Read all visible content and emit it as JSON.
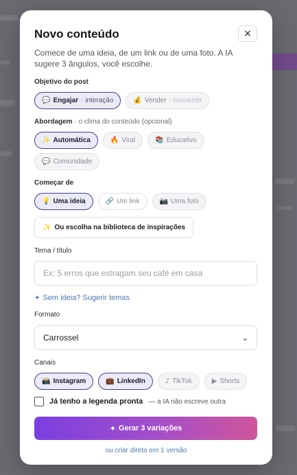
{
  "modal": {
    "title": "Novo conteúdo",
    "close_icon": "×",
    "subtitle": "Comece de uma ideia, de um link ou de uma foto. A IA sugere 3 ângulos, você escolhe."
  },
  "objective": {
    "label": "Objetivo do post",
    "options": [
      {
        "icon": "💬",
        "label": "Engajar",
        "sub": "· interação",
        "selected": true
      },
      {
        "icon": "💰",
        "label": "Vender",
        "sub": "· converter",
        "selected": false
      }
    ]
  },
  "approach": {
    "label": "Abordagem",
    "hint": " · o clima do conteúdo (opcional)",
    "options": [
      {
        "icon": "✨",
        "label": "Automática",
        "selected": true
      },
      {
        "icon": "🔥",
        "label": "Viral",
        "selected": false
      },
      {
        "icon": "📚",
        "label": "Educativo",
        "selected": false
      },
      {
        "icon": "💬",
        "label": "Comunidade",
        "selected": false
      }
    ]
  },
  "start_from": {
    "label": "Começar de",
    "options": [
      {
        "icon": "💡",
        "label": "Uma ideia",
        "selected": true
      },
      {
        "icon": "🔗",
        "label": "Um link",
        "selected": false
      },
      {
        "icon": "📷",
        "label": "Uma foto",
        "selected": false
      }
    ],
    "library_icon": "✨",
    "library_label": "Ou escolha na biblioteca de inspirações"
  },
  "topic": {
    "label": "Tema / título",
    "placeholder": "Ex: 5 erros que estragam seu café em casa",
    "value": ""
  },
  "suggest": {
    "icon": "✦",
    "label": "Sem ideia? Sugerir temas"
  },
  "format": {
    "label": "Formato",
    "value": "Carrossel",
    "chevron": "⌄"
  },
  "channels": {
    "label": "Canais",
    "options": [
      {
        "icon": "📸",
        "label": "Instagram",
        "selected": true
      },
      {
        "icon": "💼",
        "label": "LinkedIn",
        "selected": true
      },
      {
        "icon": "♪",
        "label": "TikTok",
        "selected": false
      },
      {
        "icon": "▶",
        "label": "Shorts",
        "selected": false
      }
    ]
  },
  "caption": {
    "label": "Já tenho a legenda pronta",
    "note": "— a IA não escreve outra",
    "checked": false
  },
  "actions": {
    "generate_icon": "✦",
    "generate_label": "Gerar 3 variações",
    "direct_label": "ou criar direto em 1 versão"
  }
}
